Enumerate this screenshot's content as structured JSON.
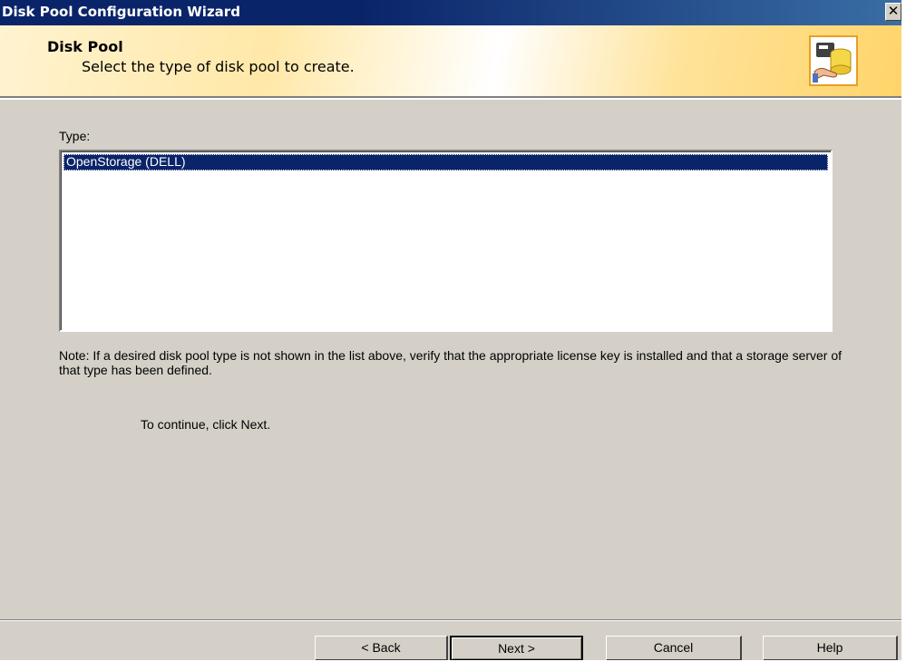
{
  "window": {
    "title": "Disk Pool Configuration Wizard",
    "close_glyph": "✕"
  },
  "header": {
    "title": "Disk Pool",
    "subtitle": "Select the type of disk pool to create.",
    "icon": "disk-pool-icon"
  },
  "body": {
    "type_label": "Type:",
    "types": [
      {
        "label": "OpenStorage (DELL)",
        "selected": true
      }
    ],
    "note": "Note: If a desired disk pool type is not shown in the list above, verify that the appropriate license key is installed and that a storage server of that type has been defined.",
    "continue_text": "To continue, click Next."
  },
  "buttons": {
    "back": "< Back",
    "next": "Next >",
    "cancel": "Cancel",
    "help": "Help"
  },
  "colors": {
    "titlebar": "#0a246a",
    "dialog_face": "#d4d0c8",
    "selection": "#0a246a",
    "banner_accent": "#ffd46a"
  }
}
